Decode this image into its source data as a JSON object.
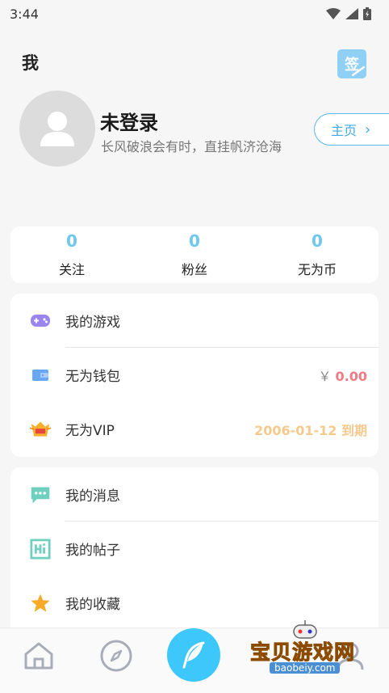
{
  "status_bar": {
    "time": "3:44"
  },
  "header": {
    "title": "我",
    "sign_label": "签"
  },
  "profile": {
    "name": "未登录",
    "motto": "长风破浪会有时，直挂帆济沧海",
    "home_label": "主页",
    "home_chevron": "›"
  },
  "stats": [
    {
      "value": "0",
      "label": "关注"
    },
    {
      "value": "0",
      "label": "粉丝"
    },
    {
      "value": "0",
      "label": "无为币"
    }
  ],
  "menu_group_1": [
    {
      "label": "我的游戏",
      "icon": "gamepad-icon"
    },
    {
      "label": "无为钱包",
      "icon": "wallet-icon",
      "currency": "￥",
      "value": "0.00"
    },
    {
      "label": "无为VIP",
      "icon": "vip-icon",
      "value": "2006-01-12 到期"
    }
  ],
  "menu_group_2": [
    {
      "label": "我的消息",
      "icon": "message-icon"
    },
    {
      "label": "我的帖子",
      "icon": "posts-icon"
    },
    {
      "label": "我的收藏",
      "icon": "star-icon"
    }
  ],
  "tab_bar": [
    "home-icon",
    "compass-icon",
    "feather-icon",
    "profile-icon"
  ],
  "watermark": {
    "text": "宝贝游戏网",
    "url": "baobeiy.com"
  },
  "colors": {
    "accent": "#3ec7fb",
    "stat": "#6ec7ee",
    "price": "#f07b85",
    "vip": "#f6c98d"
  }
}
